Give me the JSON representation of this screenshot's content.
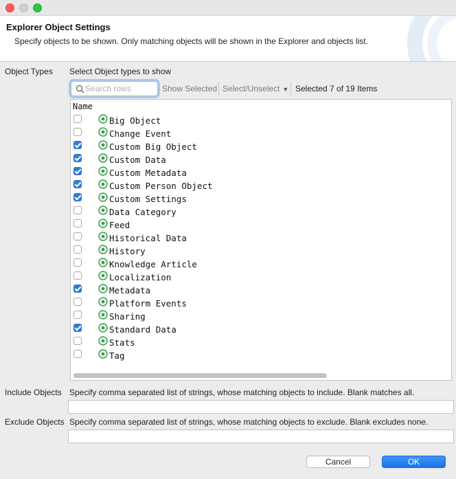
{
  "window": {
    "title": "Explorer Object Settings",
    "description": "Specify objects to be shown. Only matching objects will be shown in the Explorer and objects list."
  },
  "object_types": {
    "label": "Object Types",
    "instruction": "Select Object types to show",
    "search_placeholder": "Search rows",
    "show_selected_label": "Show Selected",
    "select_unselect_label": "Select/Unselect",
    "selected_summary": "Selected 7 of 19 Items",
    "column_header": "Name",
    "items": [
      {
        "label": "Big Object",
        "checked": false
      },
      {
        "label": "Change Event",
        "checked": false
      },
      {
        "label": "Custom Big Object",
        "checked": true
      },
      {
        "label": "Custom Data",
        "checked": true
      },
      {
        "label": "Custom Metadata",
        "checked": true
      },
      {
        "label": "Custom Person Object",
        "checked": true
      },
      {
        "label": "Custom Settings",
        "checked": true
      },
      {
        "label": "Data Category",
        "checked": false
      },
      {
        "label": "Feed",
        "checked": false
      },
      {
        "label": "Historical Data",
        "checked": false
      },
      {
        "label": "History",
        "checked": false
      },
      {
        "label": "Knowledge Article",
        "checked": false
      },
      {
        "label": "Localization",
        "checked": false
      },
      {
        "label": "Metadata",
        "checked": true
      },
      {
        "label": "Platform Events",
        "checked": false
      },
      {
        "label": "Sharing",
        "checked": false
      },
      {
        "label": "Standard Data",
        "checked": true
      },
      {
        "label": "Stats",
        "checked": false
      },
      {
        "label": "Tag",
        "checked": false
      }
    ]
  },
  "include_objects": {
    "label": "Include Objects",
    "help": "Specify comma separated list of strings, whose matching objects to include. Blank matches all.",
    "value": ""
  },
  "exclude_objects": {
    "label": "Exclude Objects",
    "help": "Specify comma separated list of strings, whose matching objects to exclude. Blank excludes none.",
    "value": ""
  },
  "buttons": {
    "cancel": "Cancel",
    "ok": "OK"
  },
  "colors": {
    "accent": "#1a76e8",
    "checkbox_checked": "#2f7fd7",
    "object_icon": "#3a9b4b"
  }
}
